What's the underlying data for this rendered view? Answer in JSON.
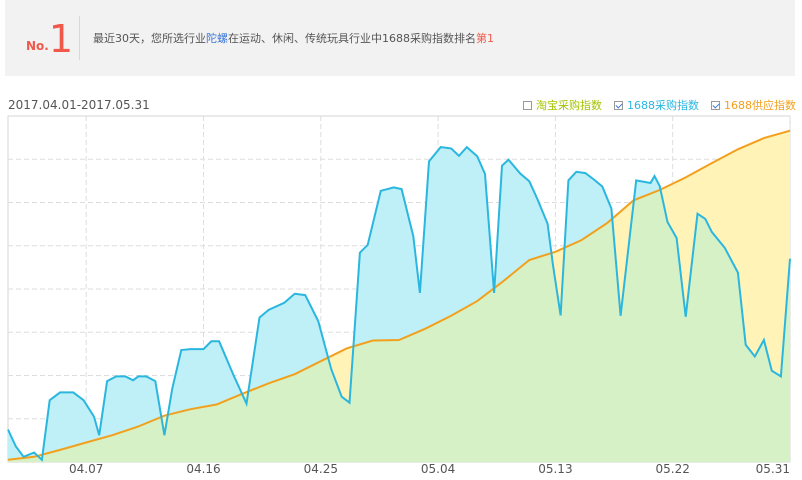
{
  "banner": {
    "rank_prefix": "No.",
    "rank_number": "1",
    "text_pre": "最近30天，您所选行业",
    "keyword": "陀螺",
    "text_mid": "在运动、休闲、传统玩具行业中1688采购指数排名",
    "rank_text": "第1"
  },
  "date_range": "2017.04.01-2017.05.31",
  "legend": [
    {
      "label": "淘宝采购指数",
      "checked": false,
      "color": "#a5c400"
    },
    {
      "label": "1688采购指数",
      "checked": true,
      "color": "#2ab6df"
    },
    {
      "label": "1688供应指数",
      "checked": true,
      "color": "#f2a01c"
    }
  ],
  "chart_data": {
    "type": "area",
    "xlabel": "",
    "ylabel": "",
    "ylim": [
      0,
      8
    ],
    "grid": true,
    "x_tick_labels": [
      "04.07",
      "04.16",
      "04.25",
      "05.04",
      "05.13",
      "05.22",
      "05.31"
    ],
    "x_tick_days": [
      6,
      15,
      24,
      33,
      42,
      51,
      60
    ],
    "colors": {
      "purchase_line": "#2ab6df",
      "purchase_fill": "#bff0f7",
      "supply_line": "#f2a01c",
      "supply_fill": "#fff3b8",
      "overlap_fill": "#d6f1c6"
    },
    "series": [
      {
        "name": "1688采购指数",
        "x": [
          0,
          0.6,
          1.2,
          2,
          2.6,
          3.2,
          4,
          5,
          5.8,
          6.6,
          7,
          7.6,
          8.3,
          9,
          9.6,
          10,
          10.6,
          11.3,
          12,
          12.6,
          13.3,
          14,
          14.6,
          15,
          15.6,
          16.2,
          17.3,
          18.3,
          19.3,
          20,
          21.2,
          22,
          22.8,
          23.8,
          24.8,
          25.6,
          26.2,
          27,
          27.6,
          28.6,
          29.6,
          30.2,
          31.1,
          31.6,
          32.3,
          33.2,
          34,
          34.6,
          35.2,
          36,
          36.6,
          37.3,
          37.9,
          38.4,
          39.3,
          40,
          40.6,
          41.4,
          41.8,
          42.4,
          43,
          43.6,
          44.3,
          45,
          45.6,
          46.3,
          47,
          48.2,
          49.3,
          49.6,
          50,
          50.6,
          51.3,
          52,
          52.9,
          53.5,
          54,
          55,
          56,
          56.6,
          57.3,
          58,
          58.6,
          59.3,
          60
        ],
        "y": [
          0.75,
          0.36,
          0.12,
          0.22,
          0.05,
          1.43,
          1.61,
          1.61,
          1.43,
          1.05,
          0.62,
          1.87,
          1.98,
          1.98,
          1.89,
          1.98,
          1.98,
          1.87,
          0.62,
          1.69,
          2.59,
          2.61,
          2.61,
          2.61,
          2.79,
          2.79,
          2.01,
          1.35,
          3.34,
          3.52,
          3.68,
          3.89,
          3.86,
          3.26,
          2.15,
          1.51,
          1.37,
          4.84,
          5.02,
          6.27,
          6.35,
          6.31,
          5.22,
          3.91,
          6.95,
          7.28,
          7.25,
          7.08,
          7.28,
          7.07,
          6.66,
          3.91,
          6.85,
          6.99,
          6.67,
          6.49,
          6.09,
          5.51,
          4.58,
          3.39,
          6.51,
          6.71,
          6.68,
          6.52,
          6.37,
          5.86,
          3.38,
          6.51,
          6.45,
          6.61,
          6.38,
          5.55,
          5.18,
          3.36,
          5.74,
          5.62,
          5.32,
          4.95,
          4.38,
          2.71,
          2.44,
          2.82,
          2.11,
          1.98,
          4.7
        ]
      },
      {
        "name": "1688供应指数",
        "x": [
          0,
          2,
          4,
          6,
          8,
          10,
          12,
          14,
          16,
          18,
          20,
          22,
          24,
          26,
          28,
          30,
          32,
          34,
          36,
          38,
          40,
          42,
          44,
          46,
          48,
          50,
          52,
          54,
          56,
          58,
          60
        ],
        "y": [
          0.05,
          0.12,
          0.28,
          0.45,
          0.62,
          0.82,
          1.07,
          1.22,
          1.33,
          1.58,
          1.82,
          2.03,
          2.33,
          2.63,
          2.81,
          2.82,
          3.08,
          3.38,
          3.72,
          4.18,
          4.67,
          4.86,
          5.13,
          5.53,
          6.05,
          6.29,
          6.58,
          6.91,
          7.23,
          7.49,
          7.66
        ]
      }
    ]
  }
}
